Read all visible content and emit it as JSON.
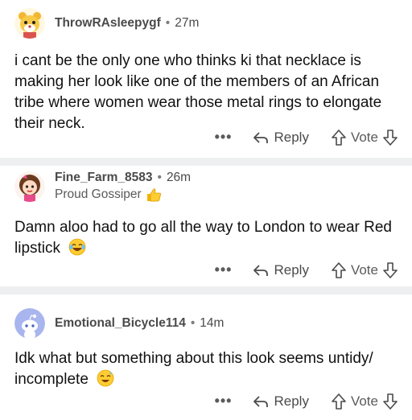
{
  "comments": [
    {
      "username": "ThrowRAsleepygf",
      "separator": "•",
      "time": "27m",
      "flair": "",
      "body": "i cant be the only one who thinks ki that necklace is making her look like one of the members of an African tribe where women wear those metal rings to elongate their neck.",
      "emoji": "",
      "more": "•••",
      "reply_label": "Reply",
      "vote_label": "Vote",
      "avatar_icon": "snoo-bear-avatar-icon"
    },
    {
      "username": "Fine_Farm_8583",
      "separator": "•",
      "time": "26m",
      "flair": "Proud Gossiper",
      "flair_emoji": "thumbs-up-emoji-icon",
      "body": "Damn aloo had to go all the way to London to wear Red lipstick",
      "emoji": "laughing-emoji-icon",
      "more": "•••",
      "reply_label": "Reply",
      "vote_label": "Vote",
      "avatar_icon": "girl-avatar-icon"
    },
    {
      "username": "Emotional_Bicycle114",
      "separator": "•",
      "time": "14m",
      "flair": "",
      "body": "Idk what but something about this look seems untidy/ incomplete",
      "emoji": "sweat-smile-emoji-icon",
      "more": "•••",
      "reply_label": "Reply",
      "vote_label": "Vote",
      "avatar_icon": "default-snoo-avatar-icon"
    }
  ],
  "colors": {
    "separator_bg": "#edeff1",
    "meta_text": "#4a4a4a",
    "body_text": "#111111",
    "default_avatar_bg": "#a8b5ee"
  }
}
